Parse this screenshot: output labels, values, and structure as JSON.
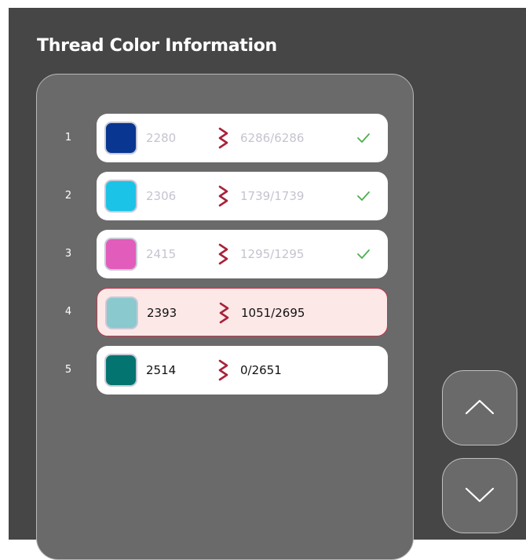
{
  "title": "Thread Color Information",
  "colors": {
    "panel_bg": "#464646",
    "list_bg": "#6a6a6a",
    "stitch_icon": "#a8233a",
    "check_icon": "#4caf50",
    "active_border": "#c0394b",
    "active_bg": "#fde8e8"
  },
  "threads": [
    {
      "index": "1",
      "code": "2280",
      "count": "6286/6286",
      "swatch": "#083690",
      "status": "done"
    },
    {
      "index": "2",
      "code": "2306",
      "count": "1739/1739",
      "swatch": "#1bc3e6",
      "status": "done"
    },
    {
      "index": "3",
      "code": "2415",
      "count": "1295/1295",
      "swatch": "#e25cbb",
      "status": "done"
    },
    {
      "index": "4",
      "code": "2393",
      "count": "1051/2695",
      "swatch": "#8ac9cd",
      "status": "active"
    },
    {
      "index": "5",
      "code": "2514",
      "count": "0/2651",
      "swatch": "#037470",
      "status": "pending"
    }
  ],
  "icons": {
    "stitch": "zigzag-stitch-icon",
    "done": "checkmark-icon",
    "scroll_up": "chevron-up-icon",
    "scroll_down": "chevron-down-icon"
  }
}
